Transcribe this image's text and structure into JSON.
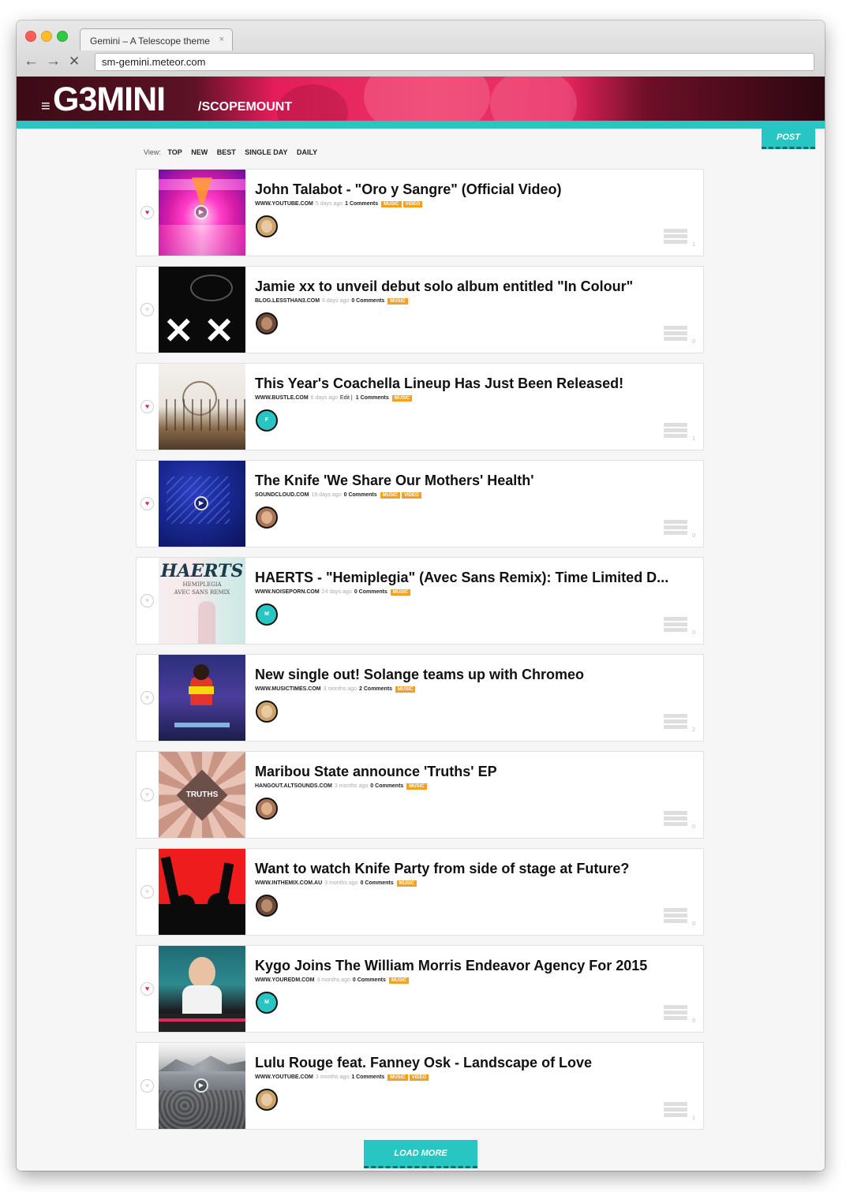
{
  "browser": {
    "tab_title": "Gemini – A Telescope theme",
    "tab_close": "×",
    "url": "sm-gemini.meteor.com",
    "back": "←",
    "forward": "→",
    "stop": "✕"
  },
  "header": {
    "menu_icon": "≡",
    "logo": "G3MINI",
    "logo_sub": "/SCOPEMOUNT",
    "post_button": "POST"
  },
  "viewbar": {
    "label": "View:",
    "items": [
      "TOP",
      "NEW",
      "BEST",
      "SINGLE DAY",
      "DAILY"
    ]
  },
  "posts": [
    {
      "title": "John Talabot - \"Oro y Sangre\" (Official Video)",
      "domain": "WWW.YOUTUBE.COM",
      "ago": "5 days ago",
      "edit": "",
      "comments": "1 Comments",
      "tags": [
        "MUSIC",
        "VIDEO"
      ],
      "comment_count": "1",
      "voted": true,
      "play": true,
      "avatar_letter": ""
    },
    {
      "title": "Jamie xx to unveil debut solo album entitled \"In Colour\"",
      "domain": "BLOG.LESSTHAN3.COM",
      "ago": "6 days ago",
      "edit": "",
      "comments": "0 Comments",
      "tags": [
        "MUSIC"
      ],
      "comment_count": "0",
      "voted": false,
      "play": false,
      "avatar_letter": ""
    },
    {
      "title": "This Year's Coachella Lineup Has Just Been Released!",
      "domain": "WWW.BUSTLE.COM",
      "ago": "6 days ago",
      "edit": "Edit |",
      "comments": "1 Comments",
      "tags": [
        "MUSIC"
      ],
      "comment_count": "1",
      "voted": true,
      "play": false,
      "avatar_letter": "F"
    },
    {
      "title": "The Knife 'We Share Our Mothers' Health'",
      "domain": "SOUNDCLOUD.COM",
      "ago": "19 days ago",
      "edit": "",
      "comments": "0 Comments",
      "tags": [
        "MUSIC",
        "VIDEO"
      ],
      "comment_count": "0",
      "voted": true,
      "play": true,
      "avatar_letter": ""
    },
    {
      "title": "HAERTS - \"Hemiplegia\" (Avec Sans Remix): Time Limited D...",
      "domain": "WWW.NOISEPORN.COM",
      "ago": "24 days ago",
      "edit": "",
      "comments": "0 Comments",
      "tags": [
        "MUSIC"
      ],
      "comment_count": "0",
      "voted": false,
      "play": false,
      "avatar_letter": "M"
    },
    {
      "title": "New single out! Solange teams up with Chromeo",
      "domain": "WWW.MUSICTIMES.COM",
      "ago": "3 months ago",
      "edit": "",
      "comments": "2 Comments",
      "tags": [
        "MUSIC"
      ],
      "comment_count": "2",
      "voted": false,
      "play": false,
      "avatar_letter": ""
    },
    {
      "title": "Maribou State announce 'Truths' EP",
      "domain": "HANGOUT.ALTSOUNDS.COM",
      "ago": "3 months ago",
      "edit": "",
      "comments": "0 Comments",
      "tags": [
        "MUSIC"
      ],
      "comment_count": "0",
      "voted": false,
      "play": false,
      "avatar_letter": ""
    },
    {
      "title": "Want to watch Knife Party from side of stage at Future?",
      "domain": "WWW.INTHEMIX.COM.AU",
      "ago": "3 months ago",
      "edit": "",
      "comments": "0 Comments",
      "tags": [
        "MUSIC"
      ],
      "comment_count": "0",
      "voted": false,
      "play": false,
      "avatar_letter": ""
    },
    {
      "title": "Kygo Joins The William Morris Endeavor Agency For 2015",
      "domain": "WWW.YOUREDM.COM",
      "ago": "3 months ago",
      "edit": "",
      "comments": "0 Comments",
      "tags": [
        "MUSIC"
      ],
      "comment_count": "0",
      "voted": true,
      "play": false,
      "avatar_letter": "M"
    },
    {
      "title": "Lulu Rouge feat. Fanney Osk - Landscape of Love",
      "domain": "WWW.YOUTUBE.COM",
      "ago": "3 months ago",
      "edit": "",
      "comments": "1 Comments",
      "tags": [
        "MUSIC",
        "VIDEO"
      ],
      "comment_count": "1",
      "voted": false,
      "play": true,
      "avatar_letter": ""
    }
  ],
  "thumb_texts": {
    "haerts_title": "HAERTS",
    "haerts_sub1": "HEMIPLEGIA",
    "haerts_sub2": "AVEC SANS REMIX",
    "maribou": "TRUTHS"
  },
  "heart_icon": "♥",
  "play_icon": "▶",
  "load_more": "LOAD MORE",
  "colors": {
    "accent": "#27c6c3",
    "brand_pink": "#e8245e",
    "tag_orange": "#f7a01d"
  }
}
